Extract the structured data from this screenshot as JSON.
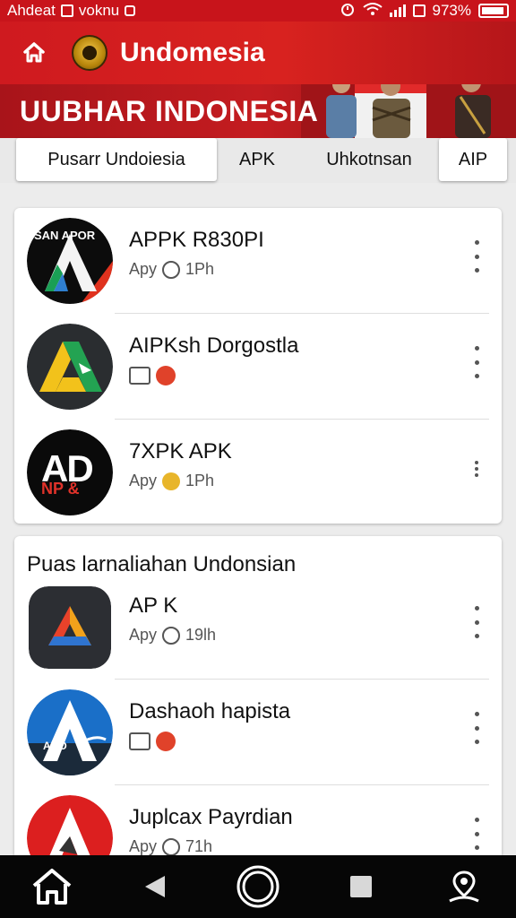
{
  "status_bar": {
    "carrier": "Ahdeat",
    "notification": "voknu",
    "battery": "973%"
  },
  "header": {
    "title": "Undomesia",
    "banner_title": "UUBHAR INDONESIA"
  },
  "tabs": [
    {
      "label": "Pusarr Undoiesia",
      "active": true
    },
    {
      "label": "APK",
      "active": false
    },
    {
      "label": "Uhkotnsan",
      "active": false
    },
    {
      "label": "AIP",
      "active": false
    }
  ],
  "list_1": {
    "items": [
      {
        "name": "APPK R830PI",
        "sub": "Apy",
        "meta": "1Ph",
        "logo_text": "SAN APOR"
      },
      {
        "name": "AIPKsh Dorgostla",
        "sub": "",
        "meta": ""
      },
      {
        "name": "7XPK APK",
        "sub": "Apy",
        "meta": "1Ph",
        "logo_text": "AD",
        "logo_subtext": "NP &"
      }
    ]
  },
  "list_2": {
    "title": "Puas larnaliahan Undonsian",
    "items": [
      {
        "name": "AP K",
        "sub": "Apy",
        "meta": "19lh"
      },
      {
        "name": "Dashaoh hapista",
        "sub": "",
        "meta": "",
        "logo_text": "ABO"
      },
      {
        "name": "Juplcax Payrdian",
        "sub": "Apy",
        "meta": "71h"
      }
    ]
  },
  "colors": {
    "brand_red": "#d0191f",
    "nav_bg": "#060606"
  }
}
